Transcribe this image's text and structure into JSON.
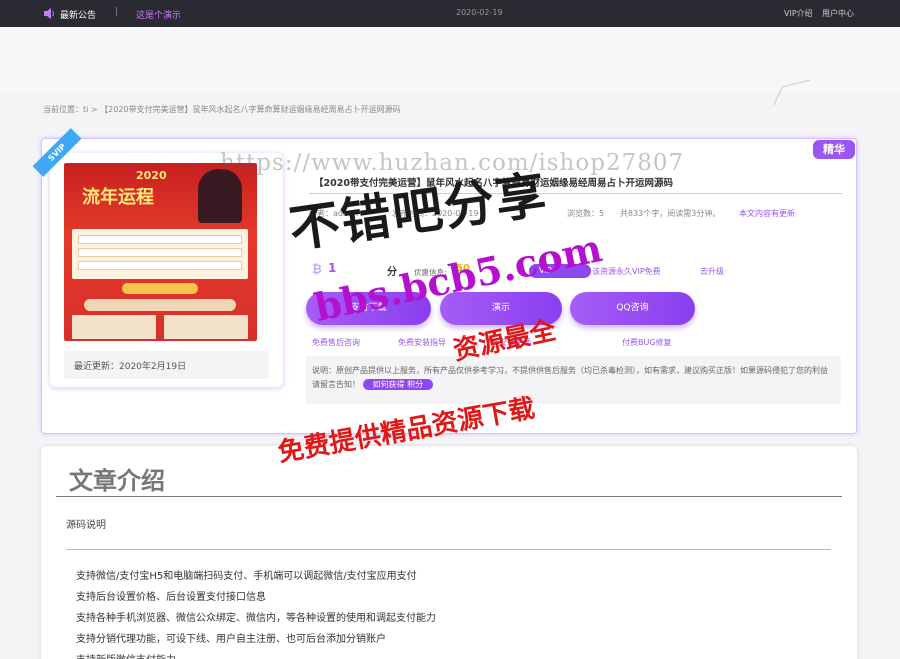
{
  "topbar": {
    "notice_label": "最新公告",
    "separator": "|",
    "demo_link": "这是个演示",
    "date": "2020-02-19",
    "vip_link": "VIP介绍",
    "user_center_link": "用户中心",
    "accent_color": "#c77dff"
  },
  "breadcrumb": "当前位置：ti > 【2020带支付完美运营】鼠年风水起名八字算命算财运姻缘易经周易占卜开运网源码",
  "product": {
    "svip_badge": "SVIP",
    "jinghua_badge": "精华",
    "title": "【2020带支付完美运营】鼠年风水起名八字算命算财运姻缘易经周易占卜开运网源码",
    "author": "作者：admin",
    "publish_time": "发布时间：2020-02-19",
    "views": "浏览数：5",
    "words": "共833个字，阅读需3分钟。",
    "content_update": "本文内容有更新",
    "price_icon": "₿",
    "price_value": "1",
    "price_unit": "分",
    "discount_label": "优惠信息:",
    "discount_value": "50",
    "vip_badge": "VIP",
    "vip_free": "该资源永久VIP免费",
    "upgrade": "去升级",
    "buttons": {
      "buy": "支付下载",
      "demo": "演示",
      "qq": "QQ咨询"
    },
    "services": [
      "免费售后咨询",
      "免费安装指导",
      "付费安装主题",
      "付费BUG修复",
      "付费BUG修复"
    ],
    "notice": "说明：原创产品提供以上服务，所有产品仅供参考学习，不提供供售后服务（均已杀毒检测），如有需求，建议购买正版！如果源码侵犯了您的利益请留言告知！",
    "how_to": "如何获得 积分",
    "poster_year": "2020",
    "poster_title": "流年运程",
    "last_update": "最近更新：2020年2月19日",
    "brand_color": "#9b55f0"
  },
  "article": {
    "title": "文章介绍",
    "source_label": "源码说明",
    "features": [
      "支持微信/支付宝H5和电脑端扫码支付、手机端可以调起微信/支付宝应用支付",
      "支持后台设置价格、后台设置支付接口信息",
      "支持各种手机浏览器、微信公众绑定、微信内，等各种设置的使用和调起支付能力",
      "支持分销代理功能，可设下线、用户自主注册、也可后台添加分销账户",
      "支持新版微信支付能力"
    ]
  },
  "watermarks": {
    "url": "https://www.huzhan.com/ishop27807",
    "big": "不错吧分享",
    "bbs": "bbs.bcb5.com",
    "red1": "资源最全",
    "red2": "免费提供精品资源下载"
  }
}
